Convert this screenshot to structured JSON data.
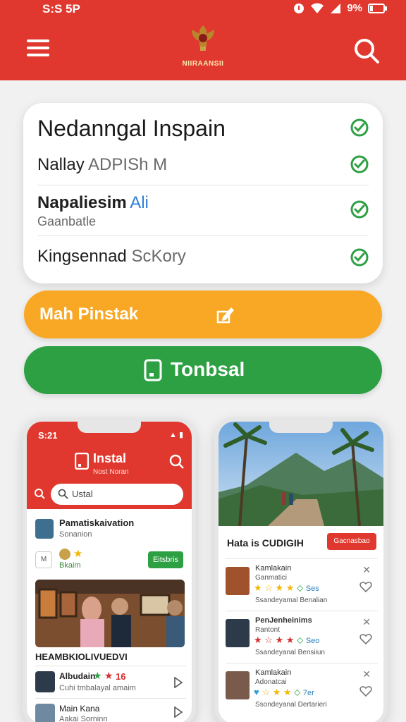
{
  "status_bar": {
    "time": "S:S 5P",
    "battery": "9%"
  },
  "app_bar": {
    "logo_text": "NIIRAANSII"
  },
  "card": {
    "title": "Nedanngal Inspain",
    "rows": [
      {
        "main": "Nallay",
        "secondary": "ADPISh M"
      },
      {
        "main": "Napaliesim",
        "accent": "Ali",
        "sub": "Gaanbatle"
      },
      {
        "main": "Kingsennad",
        "secondary": "SсKory"
      }
    ]
  },
  "buttons": {
    "orange_label": "Mah Pinstak",
    "green_label": "Tonbsal"
  },
  "phone_left": {
    "time": "S:21",
    "title": "Instal",
    "subtitle": "Nost Noran",
    "search_value": "Ustal",
    "item1_title": "Pamatiskaivation",
    "item1_sub": "Sonanion",
    "m_box": "M",
    "beem_label": "Bkaim",
    "green_button": "Eitsbris",
    "photo_caption": "HEAMBKIOLIVUEDVI",
    "list": [
      {
        "title": "Albudain",
        "rating": "16",
        "sub": "Cuhi tmbalayal amaim"
      },
      {
        "title": "Main Kana",
        "sub": "Aakai Sorninn"
      }
    ]
  },
  "phone_right": {
    "header": "Hata is CUDIGIH",
    "red_button": "Gacnasbao",
    "items": [
      {
        "title": "Kamlakain",
        "sub": "Ganmatici",
        "rating": "Ses",
        "desc": "Ssandeyamal Benalian"
      },
      {
        "title": "PenJenheinims",
        "sub": "Rantont",
        "rating": "Seo",
        "desc": "Ssandeyanal Bensiiun"
      },
      {
        "title": "Kamlakain",
        "sub": "Adonatcai",
        "rating": "7er",
        "desc": "Ssondeyanal Dertarieri"
      }
    ]
  },
  "colors": {
    "primary_red": "#e0382e",
    "orange": "#f9a825",
    "green": "#2ea044",
    "check_green": "#2ea044"
  }
}
